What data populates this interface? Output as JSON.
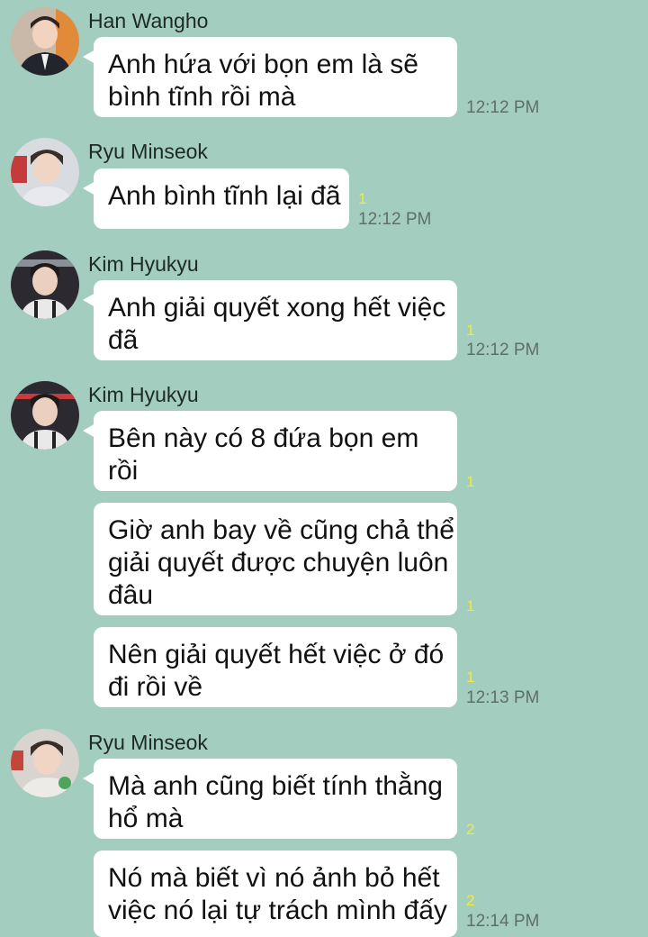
{
  "messages": [
    {
      "sender": "Han Wangho",
      "lines": [
        "Anh hứa với bọn em là sẽ",
        "bình tĩnh rồi mà"
      ],
      "unread": "",
      "time": "12:12 PM"
    },
    {
      "sender": "Ryu Minseok",
      "lines": [
        "Anh bình tĩnh lại đã"
      ],
      "unread": "1",
      "time": "12:12 PM"
    },
    {
      "sender": "Kim Hyukyu",
      "lines": [
        "Anh giải quyết xong hết việc",
        "đã"
      ],
      "unread": "1",
      "time": "12:12 PM"
    },
    {
      "sender": "Kim Hyukyu",
      "lines": [
        "Bên này có 8 đứa bọn em",
        "rồi"
      ],
      "unread": "1",
      "time": ""
    },
    {
      "sender": "",
      "lines": [
        "Giờ anh bay về cũng chả thể",
        "giải quyết được chuyện luôn",
        "đâu"
      ],
      "unread": "1",
      "time": ""
    },
    {
      "sender": "",
      "lines": [
        "Nên giải quyết hết việc ở đó",
        "đi rồi về"
      ],
      "unread": "1",
      "time": "12:13 PM"
    },
    {
      "sender": "Ryu Minseok",
      "lines": [
        "Mà anh cũng biết tính thằng",
        "hổ mà"
      ],
      "unread": "2",
      "time": ""
    },
    {
      "sender": "",
      "lines": [
        "Nó mà biết vì nó ảnh bỏ hết",
        "việc nó lại tự trách mình đấy"
      ],
      "unread": "2",
      "time": "12:14 PM"
    }
  ],
  "colors": {
    "background": "#a3cdbf",
    "bubble": "#ffffff",
    "unread": "#f4ea3a",
    "time": "#5e6f69"
  }
}
